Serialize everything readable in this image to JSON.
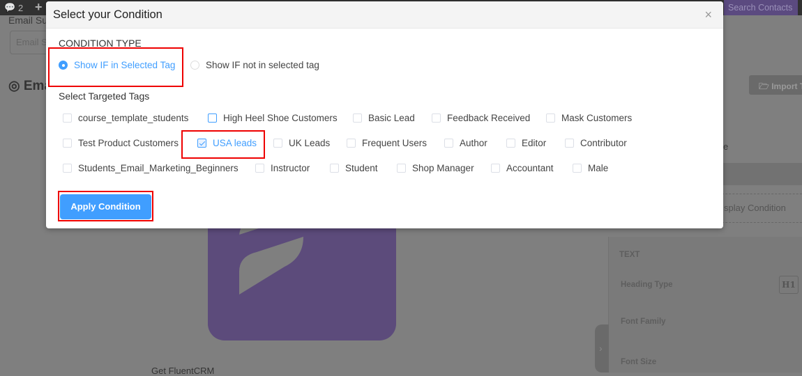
{
  "background": {
    "admin_bar": {
      "comments_count": "2",
      "plus": "+"
    },
    "email_subject_label": "Email Su",
    "email_subject_placeholder": "Email S",
    "section_title": "Ema",
    "search_contacts": "Search Contacts",
    "import_button": "Import Te",
    "partial_e": "e",
    "display_condition": "splay Condition",
    "panel": {
      "section": "TEXT",
      "heading_type": "Heading Type",
      "heading_value": "H1",
      "font_family": "Font Family",
      "font_size": "Font Size"
    },
    "footer_link": "Get FluentCRM",
    "collapse": "›"
  },
  "modal": {
    "title": "Select your Condition",
    "close": "×",
    "condition_type_label": "CONDITION TYPE",
    "options": [
      {
        "label": "Show IF in Selected Tag",
        "selected": true
      },
      {
        "label": "Show IF not in selected tag",
        "selected": false
      }
    ],
    "tags_label": "Select Targeted Tags",
    "tags": [
      {
        "label": "course_template_students",
        "checked": false
      },
      {
        "label": "High Heel Shoe Customers",
        "checked": false
      },
      {
        "label": "Basic Lead",
        "checked": false
      },
      {
        "label": "Feedback Received",
        "checked": false
      },
      {
        "label": "Mask Customers",
        "checked": false
      },
      {
        "label": "Test Product Customers",
        "checked": false
      },
      {
        "label": "USA leads",
        "checked": true
      },
      {
        "label": "UK Leads",
        "checked": false
      },
      {
        "label": "Frequent Users",
        "checked": false
      },
      {
        "label": "Author",
        "checked": false
      },
      {
        "label": "Editor",
        "checked": false
      },
      {
        "label": "Contributor",
        "checked": false
      },
      {
        "label": "Students_Email_Marketing_Beginners",
        "checked": false
      },
      {
        "label": "Instructor",
        "checked": false
      },
      {
        "label": "Student",
        "checked": false
      },
      {
        "label": "Shop Manager",
        "checked": false
      },
      {
        "label": "Accountant",
        "checked": false
      },
      {
        "label": "Male",
        "checked": false
      }
    ],
    "apply_button": "Apply Condition"
  },
  "colors": {
    "accent": "#409eff",
    "highlight": "#ee0000"
  }
}
